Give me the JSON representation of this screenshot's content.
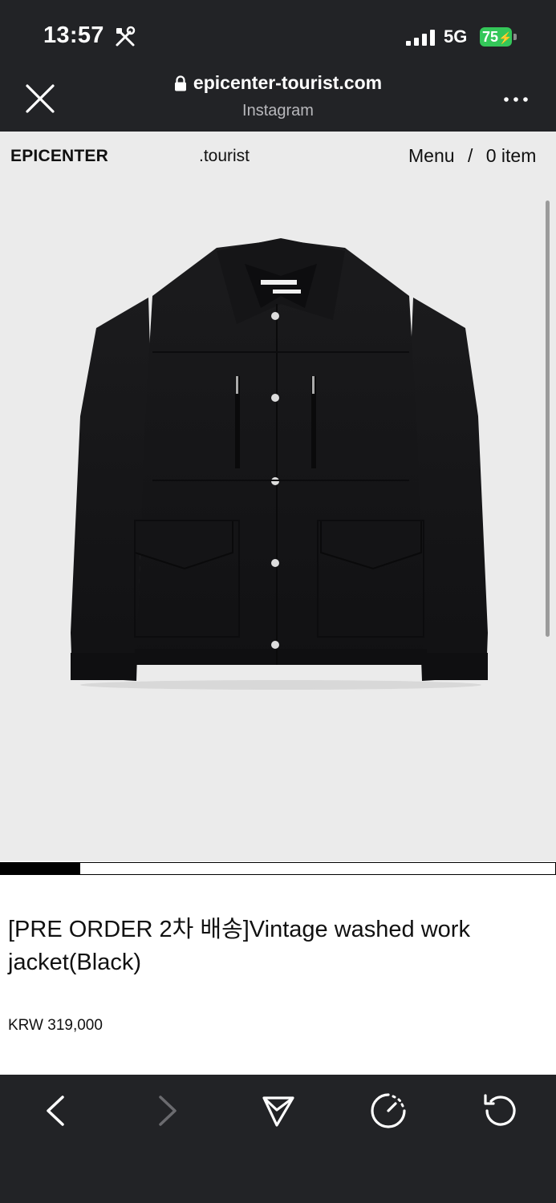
{
  "status_bar": {
    "time": "13:57",
    "network": "5G",
    "battery": "75"
  },
  "browser": {
    "url": "epicenter-tourist.com",
    "source": "Instagram"
  },
  "site_header": {
    "brand": "EPICENTER",
    "brand_suffix": ".tourist",
    "menu_label": "Menu",
    "separator": "/",
    "cart_label": "0 item"
  },
  "gallery": {
    "progress_fraction": 0.145
  },
  "product": {
    "title": "[PRE ORDER 2차 배송]Vintage washed work jacket(Black)",
    "price": "KRW 319,000"
  },
  "colors": {
    "chrome_bg": "#222326",
    "page_bg": "#ebebeb",
    "battery_green": "#34c759"
  },
  "icons": [
    "tools-icon",
    "signal-icon",
    "lock-icon",
    "close-icon",
    "more-icon",
    "back-icon",
    "forward-icon",
    "share-icon",
    "speed-icon",
    "reload-icon"
  ]
}
